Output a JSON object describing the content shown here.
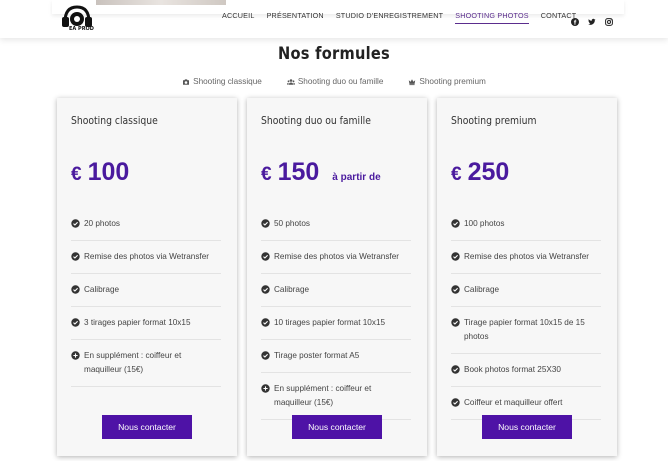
{
  "header": {
    "logo_text": "EA PROD",
    "nav": [
      {
        "label": "ACCUEIL",
        "active": false
      },
      {
        "label": "PRÉSENTATION",
        "active": false
      },
      {
        "label": "STUDIO D'ENREGISTREMENT",
        "active": false
      },
      {
        "label": "SHOOTING PHOTOS",
        "active": true
      },
      {
        "label": "CONTACT",
        "active": false
      }
    ],
    "social_icons": [
      "facebook-icon",
      "twitter-icon",
      "instagram-icon"
    ]
  },
  "section": {
    "title": "Nos formules",
    "tabs": [
      {
        "label": "Shooting classique",
        "icon": "camera-icon"
      },
      {
        "label": "Shooting duo ou famille",
        "icon": "users-icon"
      },
      {
        "label": "Shooting premium",
        "icon": "crown-icon"
      }
    ]
  },
  "cards": [
    {
      "title": "Shooting classique",
      "currency": "€",
      "price": "100",
      "price_suffix": "",
      "features": [
        {
          "text": "20 photos",
          "icon": "check-circle-icon"
        },
        {
          "text": "Remise des photos via Wetransfer",
          "icon": "check-circle-icon"
        },
        {
          "text": "Calibrage",
          "icon": "check-circle-icon"
        },
        {
          "text": "3 tirages papier format 10x15",
          "icon": "check-circle-icon"
        },
        {
          "text": "En supplément : coiffeur et maquilleur (15€)",
          "icon": "plus-circle-icon"
        }
      ],
      "cta": "Nous contacter"
    },
    {
      "title": "Shooting duo ou famille",
      "currency": "€",
      "price": "150",
      "price_suffix": "à partir de",
      "features": [
        {
          "text": "50 photos",
          "icon": "check-circle-icon"
        },
        {
          "text": "Remise des photos via Wetransfer",
          "icon": "check-circle-icon"
        },
        {
          "text": "Calibrage",
          "icon": "check-circle-icon"
        },
        {
          "text": "10 tirages papier format 10x15",
          "icon": "check-circle-icon"
        },
        {
          "text": "Tirage poster format A5",
          "icon": "check-circle-icon"
        },
        {
          "text": "En supplément : coiffeur et maquilleur (15€)",
          "icon": "plus-circle-icon"
        }
      ],
      "cta": "Nous contacter"
    },
    {
      "title": "Shooting premium",
      "currency": "€",
      "price": "250",
      "price_suffix": "",
      "features": [
        {
          "text": "100 photos",
          "icon": "check-circle-icon"
        },
        {
          "text": "Remise des photos via Wetransfer",
          "icon": "check-circle-icon"
        },
        {
          "text": "Calibrage",
          "icon": "check-circle-icon"
        },
        {
          "text": "Tirage papier format 10x15 de 15 photos",
          "icon": "check-circle-icon"
        },
        {
          "text": "Book photos format 25X30",
          "icon": "check-circle-icon"
        },
        {
          "text": "Coiffeur et maquilleur offert",
          "icon": "check-circle-icon"
        }
      ],
      "cta": "Nous contacter"
    }
  ],
  "colors": {
    "accent": "#4e12a6",
    "price": "#4a1a9e",
    "nav_active": "#5b2d8e"
  }
}
